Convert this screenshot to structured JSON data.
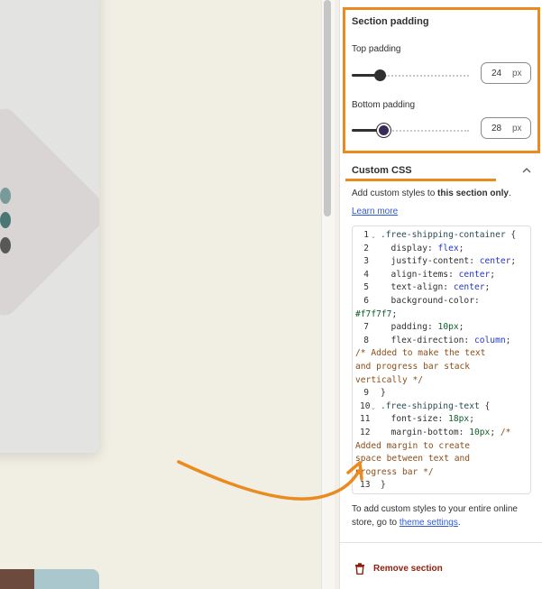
{
  "section_padding": {
    "title": "Section padding",
    "top_label": "Top padding",
    "top_value": "24",
    "top_fraction": 0.24,
    "bottom_label": "Bottom padding",
    "bottom_value": "28",
    "bottom_fraction": 0.28,
    "unit": "px"
  },
  "custom_css": {
    "title": "Custom CSS",
    "description_prefix": "Add custom styles to ",
    "description_bold": "this section only",
    "description_suffix": ".",
    "learn_more": "Learn more",
    "lines": [
      {
        "n": "1",
        "text": ".free-shipping-container {"
      },
      {
        "n": "2",
        "text": "  display: flex;"
      },
      {
        "n": "3",
        "text": "  justify-content: center;"
      },
      {
        "n": "4",
        "text": "  align-items: center;"
      },
      {
        "n": "5",
        "text": "  text-align: center;"
      },
      {
        "n": "6",
        "text": "  background-color:"
      },
      {
        "n": "",
        "text": "#f7f7f7;"
      },
      {
        "n": "7",
        "text": "  padding: 10px;"
      },
      {
        "n": "8",
        "text": "  flex-direction: column;"
      },
      {
        "n": "",
        "text": "/* Added to make the text"
      },
      {
        "n": "",
        "text": "and progress bar stack"
      },
      {
        "n": "",
        "text": "vertically */"
      },
      {
        "n": "9",
        "text": "}"
      },
      {
        "n": "10",
        "text": ".free-shipping-text {"
      },
      {
        "n": "11",
        "text": "  font-size: 18px;"
      },
      {
        "n": "12",
        "text": "  margin-bottom: 10px; /*"
      },
      {
        "n": "",
        "text": "Added margin to create"
      },
      {
        "n": "",
        "text": "space between text and"
      },
      {
        "n": "",
        "text": "progress bar */"
      },
      {
        "n": "13",
        "text": "}"
      }
    ],
    "footer_prefix": "To add custom styles to your entire online store, go to ",
    "footer_link": "theme settings",
    "footer_suffix": "."
  },
  "remove_section": "Remove section",
  "colors": {
    "highlight": "#ea8a1f",
    "link": "#2c5ad1",
    "danger": "#8e1f0b"
  },
  "icons": [
    "chevron-up-icon",
    "fold-chevron-icon",
    "trash-icon",
    "annotation-arrow"
  ]
}
